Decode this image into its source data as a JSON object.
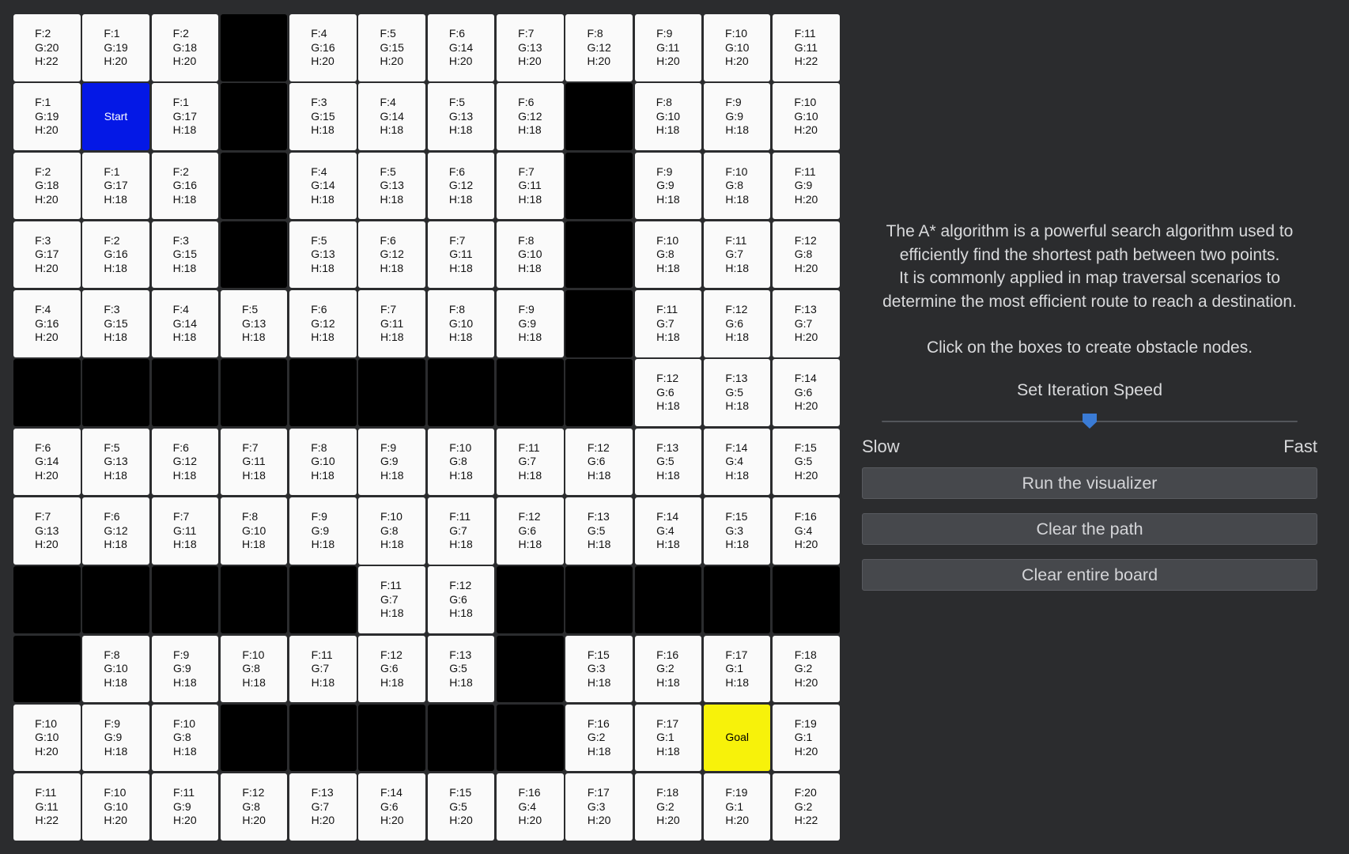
{
  "grid": {
    "rows": [
      [
        {
          "t": "n",
          "v": [
            "F:2",
            "G:20",
            "H:22"
          ]
        },
        {
          "t": "n",
          "v": [
            "F:1",
            "G:19",
            "H:20"
          ]
        },
        {
          "t": "n",
          "v": [
            "F:2",
            "G:18",
            "H:20"
          ]
        },
        {
          "t": "w"
        },
        {
          "t": "n",
          "v": [
            "F:4",
            "G:16",
            "H:20"
          ]
        },
        {
          "t": "n",
          "v": [
            "F:5",
            "G:15",
            "H:20"
          ]
        },
        {
          "t": "n",
          "v": [
            "F:6",
            "G:14",
            "H:20"
          ]
        },
        {
          "t": "n",
          "v": [
            "F:7",
            "G:13",
            "H:20"
          ]
        },
        {
          "t": "n",
          "v": [
            "F:8",
            "G:12",
            "H:20"
          ]
        },
        {
          "t": "n",
          "v": [
            "F:9",
            "G:11",
            "H:20"
          ]
        },
        {
          "t": "n",
          "v": [
            "F:10",
            "G:10",
            "H:20"
          ]
        },
        {
          "t": "n",
          "v": [
            "F:11",
            "G:11",
            "H:22"
          ]
        }
      ],
      [
        {
          "t": "n",
          "v": [
            "F:1",
            "G:19",
            "H:20"
          ]
        },
        {
          "t": "s",
          "label": "Start"
        },
        {
          "t": "n",
          "v": [
            "F:1",
            "G:17",
            "H:18"
          ]
        },
        {
          "t": "w"
        },
        {
          "t": "n",
          "v": [
            "F:3",
            "G:15",
            "H:18"
          ]
        },
        {
          "t": "n",
          "v": [
            "F:4",
            "G:14",
            "H:18"
          ]
        },
        {
          "t": "n",
          "v": [
            "F:5",
            "G:13",
            "H:18"
          ]
        },
        {
          "t": "n",
          "v": [
            "F:6",
            "G:12",
            "H:18"
          ]
        },
        {
          "t": "w"
        },
        {
          "t": "n",
          "v": [
            "F:8",
            "G:10",
            "H:18"
          ]
        },
        {
          "t": "n",
          "v": [
            "F:9",
            "G:9",
            "H:18"
          ]
        },
        {
          "t": "n",
          "v": [
            "F:10",
            "G:10",
            "H:20"
          ]
        }
      ],
      [
        {
          "t": "n",
          "v": [
            "F:2",
            "G:18",
            "H:20"
          ]
        },
        {
          "t": "n",
          "v": [
            "F:1",
            "G:17",
            "H:18"
          ]
        },
        {
          "t": "n",
          "v": [
            "F:2",
            "G:16",
            "H:18"
          ]
        },
        {
          "t": "w"
        },
        {
          "t": "n",
          "v": [
            "F:4",
            "G:14",
            "H:18"
          ]
        },
        {
          "t": "n",
          "v": [
            "F:5",
            "G:13",
            "H:18"
          ]
        },
        {
          "t": "n",
          "v": [
            "F:6",
            "G:12",
            "H:18"
          ]
        },
        {
          "t": "n",
          "v": [
            "F:7",
            "G:11",
            "H:18"
          ]
        },
        {
          "t": "w"
        },
        {
          "t": "n",
          "v": [
            "F:9",
            "G:9",
            "H:18"
          ]
        },
        {
          "t": "n",
          "v": [
            "F:10",
            "G:8",
            "H:18"
          ]
        },
        {
          "t": "n",
          "v": [
            "F:11",
            "G:9",
            "H:20"
          ]
        }
      ],
      [
        {
          "t": "n",
          "v": [
            "F:3",
            "G:17",
            "H:20"
          ]
        },
        {
          "t": "n",
          "v": [
            "F:2",
            "G:16",
            "H:18"
          ]
        },
        {
          "t": "n",
          "v": [
            "F:3",
            "G:15",
            "H:18"
          ]
        },
        {
          "t": "w"
        },
        {
          "t": "n",
          "v": [
            "F:5",
            "G:13",
            "H:18"
          ]
        },
        {
          "t": "n",
          "v": [
            "F:6",
            "G:12",
            "H:18"
          ]
        },
        {
          "t": "n",
          "v": [
            "F:7",
            "G:11",
            "H:18"
          ]
        },
        {
          "t": "n",
          "v": [
            "F:8",
            "G:10",
            "H:18"
          ]
        },
        {
          "t": "w"
        },
        {
          "t": "n",
          "v": [
            "F:10",
            "G:8",
            "H:18"
          ]
        },
        {
          "t": "n",
          "v": [
            "F:11",
            "G:7",
            "H:18"
          ]
        },
        {
          "t": "n",
          "v": [
            "F:12",
            "G:8",
            "H:20"
          ]
        }
      ],
      [
        {
          "t": "n",
          "v": [
            "F:4",
            "G:16",
            "H:20"
          ]
        },
        {
          "t": "n",
          "v": [
            "F:3",
            "G:15",
            "H:18"
          ]
        },
        {
          "t": "n",
          "v": [
            "F:4",
            "G:14",
            "H:18"
          ]
        },
        {
          "t": "n",
          "v": [
            "F:5",
            "G:13",
            "H:18"
          ]
        },
        {
          "t": "n",
          "v": [
            "F:6",
            "G:12",
            "H:18"
          ]
        },
        {
          "t": "n",
          "v": [
            "F:7",
            "G:11",
            "H:18"
          ]
        },
        {
          "t": "n",
          "v": [
            "F:8",
            "G:10",
            "H:18"
          ]
        },
        {
          "t": "n",
          "v": [
            "F:9",
            "G:9",
            "H:18"
          ]
        },
        {
          "t": "w"
        },
        {
          "t": "n",
          "v": [
            "F:11",
            "G:7",
            "H:18"
          ]
        },
        {
          "t": "n",
          "v": [
            "F:12",
            "G:6",
            "H:18"
          ]
        },
        {
          "t": "n",
          "v": [
            "F:13",
            "G:7",
            "H:20"
          ]
        }
      ],
      [
        {
          "t": "w"
        },
        {
          "t": "w"
        },
        {
          "t": "w"
        },
        {
          "t": "w"
        },
        {
          "t": "w"
        },
        {
          "t": "w"
        },
        {
          "t": "w"
        },
        {
          "t": "w"
        },
        {
          "t": "w"
        },
        {
          "t": "n",
          "v": [
            "F:12",
            "G:6",
            "H:18"
          ]
        },
        {
          "t": "n",
          "v": [
            "F:13",
            "G:5",
            "H:18"
          ]
        },
        {
          "t": "n",
          "v": [
            "F:14",
            "G:6",
            "H:20"
          ]
        }
      ],
      [
        {
          "t": "n",
          "v": [
            "F:6",
            "G:14",
            "H:20"
          ]
        },
        {
          "t": "n",
          "v": [
            "F:5",
            "G:13",
            "H:18"
          ]
        },
        {
          "t": "n",
          "v": [
            "F:6",
            "G:12",
            "H:18"
          ]
        },
        {
          "t": "n",
          "v": [
            "F:7",
            "G:11",
            "H:18"
          ]
        },
        {
          "t": "n",
          "v": [
            "F:8",
            "G:10",
            "H:18"
          ]
        },
        {
          "t": "n",
          "v": [
            "F:9",
            "G:9",
            "H:18"
          ]
        },
        {
          "t": "n",
          "v": [
            "F:10",
            "G:8",
            "H:18"
          ]
        },
        {
          "t": "n",
          "v": [
            "F:11",
            "G:7",
            "H:18"
          ]
        },
        {
          "t": "n",
          "v": [
            "F:12",
            "G:6",
            "H:18"
          ]
        },
        {
          "t": "n",
          "v": [
            "F:13",
            "G:5",
            "H:18"
          ]
        },
        {
          "t": "n",
          "v": [
            "F:14",
            "G:4",
            "H:18"
          ]
        },
        {
          "t": "n",
          "v": [
            "F:15",
            "G:5",
            "H:20"
          ]
        }
      ],
      [
        {
          "t": "n",
          "v": [
            "F:7",
            "G:13",
            "H:20"
          ]
        },
        {
          "t": "n",
          "v": [
            "F:6",
            "G:12",
            "H:18"
          ]
        },
        {
          "t": "n",
          "v": [
            "F:7",
            "G:11",
            "H:18"
          ]
        },
        {
          "t": "n",
          "v": [
            "F:8",
            "G:10",
            "H:18"
          ]
        },
        {
          "t": "n",
          "v": [
            "F:9",
            "G:9",
            "H:18"
          ]
        },
        {
          "t": "n",
          "v": [
            "F:10",
            "G:8",
            "H:18"
          ]
        },
        {
          "t": "n",
          "v": [
            "F:11",
            "G:7",
            "H:18"
          ]
        },
        {
          "t": "n",
          "v": [
            "F:12",
            "G:6",
            "H:18"
          ]
        },
        {
          "t": "n",
          "v": [
            "F:13",
            "G:5",
            "H:18"
          ]
        },
        {
          "t": "n",
          "v": [
            "F:14",
            "G:4",
            "H:18"
          ]
        },
        {
          "t": "n",
          "v": [
            "F:15",
            "G:3",
            "H:18"
          ]
        },
        {
          "t": "n",
          "v": [
            "F:16",
            "G:4",
            "H:20"
          ]
        }
      ],
      [
        {
          "t": "w"
        },
        {
          "t": "w"
        },
        {
          "t": "w"
        },
        {
          "t": "w"
        },
        {
          "t": "w"
        },
        {
          "t": "n",
          "v": [
            "F:11",
            "G:7",
            "H:18"
          ]
        },
        {
          "t": "n",
          "v": [
            "F:12",
            "G:6",
            "H:18"
          ]
        },
        {
          "t": "w"
        },
        {
          "t": "w"
        },
        {
          "t": "w"
        },
        {
          "t": "w"
        },
        {
          "t": "w"
        }
      ],
      [
        {
          "t": "w"
        },
        {
          "t": "n",
          "v": [
            "F:8",
            "G:10",
            "H:18"
          ]
        },
        {
          "t": "n",
          "v": [
            "F:9",
            "G:9",
            "H:18"
          ]
        },
        {
          "t": "n",
          "v": [
            "F:10",
            "G:8",
            "H:18"
          ]
        },
        {
          "t": "n",
          "v": [
            "F:11",
            "G:7",
            "H:18"
          ]
        },
        {
          "t": "n",
          "v": [
            "F:12",
            "G:6",
            "H:18"
          ]
        },
        {
          "t": "n",
          "v": [
            "F:13",
            "G:5",
            "H:18"
          ]
        },
        {
          "t": "w"
        },
        {
          "t": "n",
          "v": [
            "F:15",
            "G:3",
            "H:18"
          ]
        },
        {
          "t": "n",
          "v": [
            "F:16",
            "G:2",
            "H:18"
          ]
        },
        {
          "t": "n",
          "v": [
            "F:17",
            "G:1",
            "H:18"
          ]
        },
        {
          "t": "n",
          "v": [
            "F:18",
            "G:2",
            "H:20"
          ]
        }
      ],
      [
        {
          "t": "n",
          "v": [
            "F:10",
            "G:10",
            "H:20"
          ]
        },
        {
          "t": "n",
          "v": [
            "F:9",
            "G:9",
            "H:18"
          ]
        },
        {
          "t": "n",
          "v": [
            "F:10",
            "G:8",
            "H:18"
          ]
        },
        {
          "t": "w"
        },
        {
          "t": "w"
        },
        {
          "t": "w"
        },
        {
          "t": "w"
        },
        {
          "t": "w"
        },
        {
          "t": "n",
          "v": [
            "F:16",
            "G:2",
            "H:18"
          ]
        },
        {
          "t": "n",
          "v": [
            "F:17",
            "G:1",
            "H:18"
          ]
        },
        {
          "t": "g",
          "label": "Goal"
        },
        {
          "t": "n",
          "v": [
            "F:19",
            "G:1",
            "H:20"
          ]
        }
      ],
      [
        {
          "t": "n",
          "v": [
            "F:11",
            "G:11",
            "H:22"
          ]
        },
        {
          "t": "n",
          "v": [
            "F:10",
            "G:10",
            "H:20"
          ]
        },
        {
          "t": "n",
          "v": [
            "F:11",
            "G:9",
            "H:20"
          ]
        },
        {
          "t": "n",
          "v": [
            "F:12",
            "G:8",
            "H:20"
          ]
        },
        {
          "t": "n",
          "v": [
            "F:13",
            "G:7",
            "H:20"
          ]
        },
        {
          "t": "n",
          "v": [
            "F:14",
            "G:6",
            "H:20"
          ]
        },
        {
          "t": "n",
          "v": [
            "F:15",
            "G:5",
            "H:20"
          ]
        },
        {
          "t": "n",
          "v": [
            "F:16",
            "G:4",
            "H:20"
          ]
        },
        {
          "t": "n",
          "v": [
            "F:17",
            "G:3",
            "H:20"
          ]
        },
        {
          "t": "n",
          "v": [
            "F:18",
            "G:2",
            "H:20"
          ]
        },
        {
          "t": "n",
          "v": [
            "F:19",
            "G:1",
            "H:20"
          ]
        },
        {
          "t": "n",
          "v": [
            "F:20",
            "G:2",
            "H:22"
          ]
        }
      ]
    ]
  },
  "panel": {
    "description": [
      "The A* algorithm is a powerful search algorithm used to",
      "efficiently find the shortest path between two points.",
      "It is commonly applied in map traversal scenarios to",
      "determine the most efficient route to reach a destination."
    ],
    "hint": "Click on the boxes to create obstacle nodes.",
    "speed_label": "Set Iteration Speed",
    "speed_value": 0.5,
    "slow_label": "Slow",
    "fast_label": "Fast",
    "buttons": {
      "run": "Run the visualizer",
      "clear_path": "Clear the path",
      "clear_board": "Clear entire board"
    }
  },
  "colors": {
    "background": "#2b2c2e",
    "cell": "#fafafa",
    "wall": "#000000",
    "start": "#0418e6",
    "goal": "#f7f20a",
    "accent": "#3a7bd5",
    "button": "#46484c"
  }
}
